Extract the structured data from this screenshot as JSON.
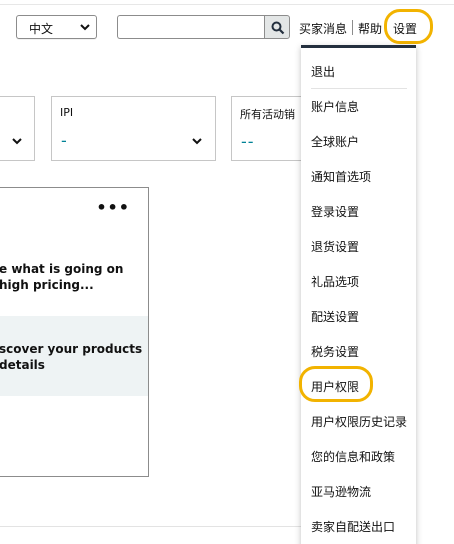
{
  "header": {
    "language": {
      "value": "中文"
    },
    "search": {
      "placeholder": ""
    },
    "links": {
      "buyer_messages": "买家消息",
      "help": "帮助",
      "settings": "设置"
    }
  },
  "cards": {
    "ipi": {
      "label": "IPI",
      "value": "-"
    },
    "all_active": {
      "label": "所有活动销",
      "value": "--"
    }
  },
  "panel": {
    "more": "•••",
    "text1_line1": "e what is going on",
    "text1_line2": "high pricing...",
    "text2_line1": "scover your products",
    "text2_line2": "details"
  },
  "settings_menu": {
    "items": [
      "退出",
      "账户信息",
      "全球账户",
      "通知首选项",
      "登录设置",
      "退货设置",
      "礼品选项",
      "配送设置",
      "税务设置",
      "用户权限",
      "用户权限历史记录",
      "您的信息和政策",
      "亚马逊物流",
      "卖家自配送出口"
    ]
  },
  "colors": {
    "accent": "#f2b300",
    "metric": "#008296",
    "menu_top": "#232f3e"
  }
}
